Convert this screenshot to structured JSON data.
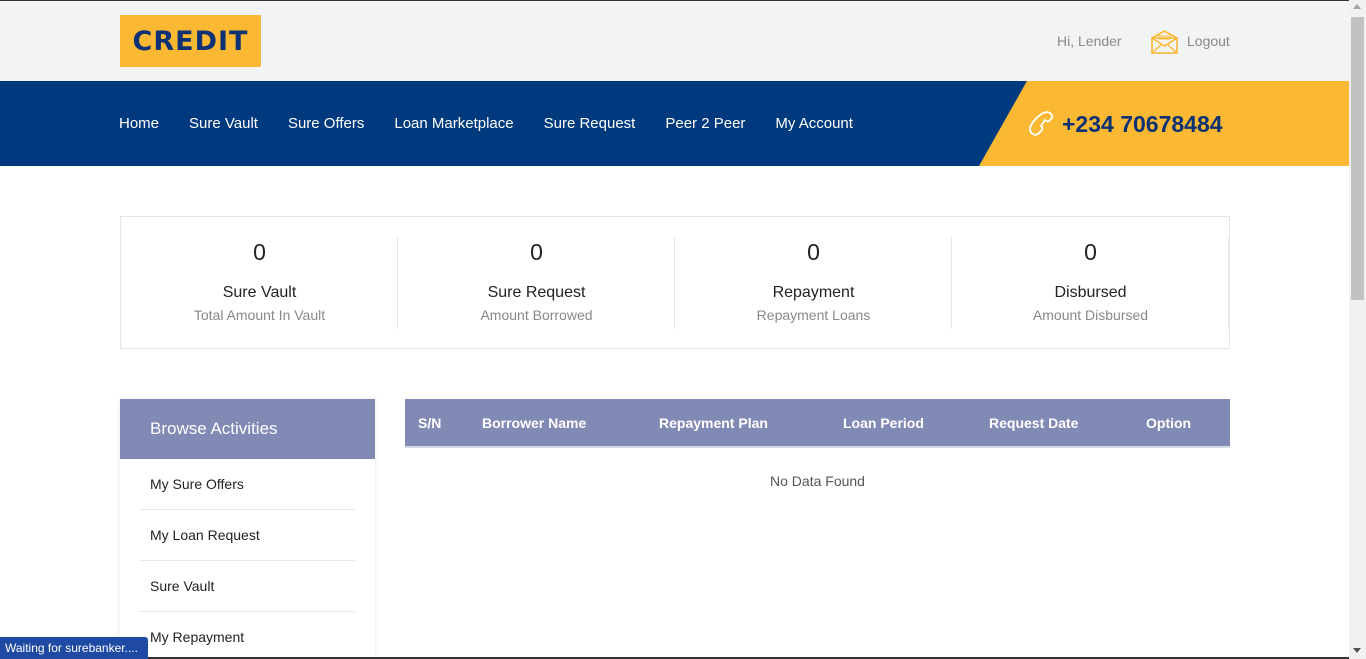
{
  "header": {
    "logo_text": "CREDIT",
    "greeting": "Hi, Lender",
    "logout_label": "Logout",
    "phone": "+234 70678484"
  },
  "nav": {
    "items": [
      "Home",
      "Sure Vault",
      "Sure Offers",
      "Loan Marketplace",
      "Sure Request",
      "Peer 2 Peer",
      "My Account"
    ]
  },
  "stats": [
    {
      "value": "0",
      "title": "Sure Vault",
      "subtitle": "Total Amount In Vault"
    },
    {
      "value": "0",
      "title": "Sure Request",
      "subtitle": "Amount Borrowed"
    },
    {
      "value": "0",
      "title": "Repayment",
      "subtitle": "Repayment Loans"
    },
    {
      "value": "0",
      "title": "Disbursed",
      "subtitle": "Amount Disbursed"
    }
  ],
  "sidebar": {
    "title": "Browse Activities",
    "items": [
      "My Sure Offers",
      "My Loan Request",
      "Sure Vault",
      "My Repayment"
    ]
  },
  "table": {
    "headers": [
      "S/N",
      "Borrower Name",
      "Repayment Plan",
      "Loan Period",
      "Request Date",
      "Option"
    ],
    "empty_text": "No Data Found"
  },
  "status_bar": "Waiting for surebanker....",
  "colors": {
    "brand_yellow": "#fbb933",
    "brand_navy": "#003a7e",
    "table_header": "#8189b5"
  },
  "icons": {
    "mail": "envelope-icon",
    "phone": "phone-icon"
  }
}
